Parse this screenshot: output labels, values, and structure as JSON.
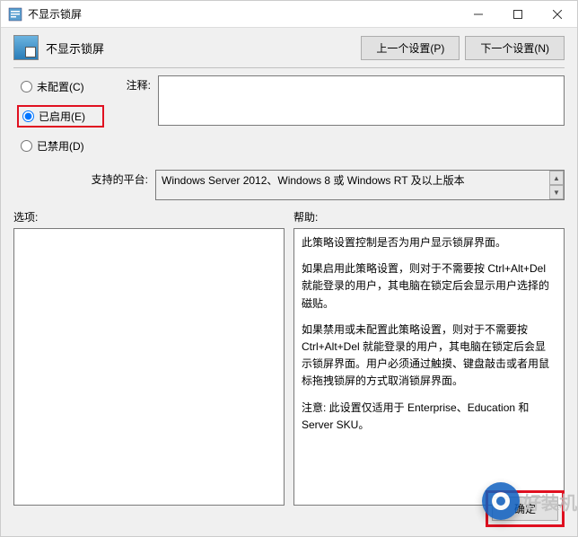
{
  "window": {
    "title": "不显示锁屏"
  },
  "header": {
    "title": "不显示锁屏",
    "prev_btn": "上一个设置(P)",
    "next_btn": "下一个设置(N)"
  },
  "radios": {
    "not_configured": "未配置(C)",
    "enabled": "已启用(E)",
    "disabled": "已禁用(D)",
    "selected": "enabled"
  },
  "comment": {
    "label": "注释:",
    "value": ""
  },
  "platform": {
    "label": "支持的平台:",
    "value": "Windows Server 2012、Windows 8 或 Windows RT 及以上版本"
  },
  "options": {
    "label": "选项:"
  },
  "help": {
    "label": "帮助:",
    "p1": "此策略设置控制是否为用户显示锁屏界面。",
    "p2": "如果启用此策略设置，则对于不需要按 Ctrl+Alt+Del 就能登录的用户，其电脑在锁定后会显示用户选择的磁贴。",
    "p3": "如果禁用或未配置此策略设置，则对于不需要按 Ctrl+Alt+Del 就能登录的用户，其电脑在锁定后会显示锁屏界面。用户必须通过触摸、键盘敲击或者用鼠标拖拽锁屏的方式取消锁屏界面。",
    "p4": "注意: 此设置仅适用于 Enterprise、Education 和 Server SKU。"
  },
  "footer": {
    "ok": "确定"
  },
  "watermark": {
    "text": "好装机"
  }
}
